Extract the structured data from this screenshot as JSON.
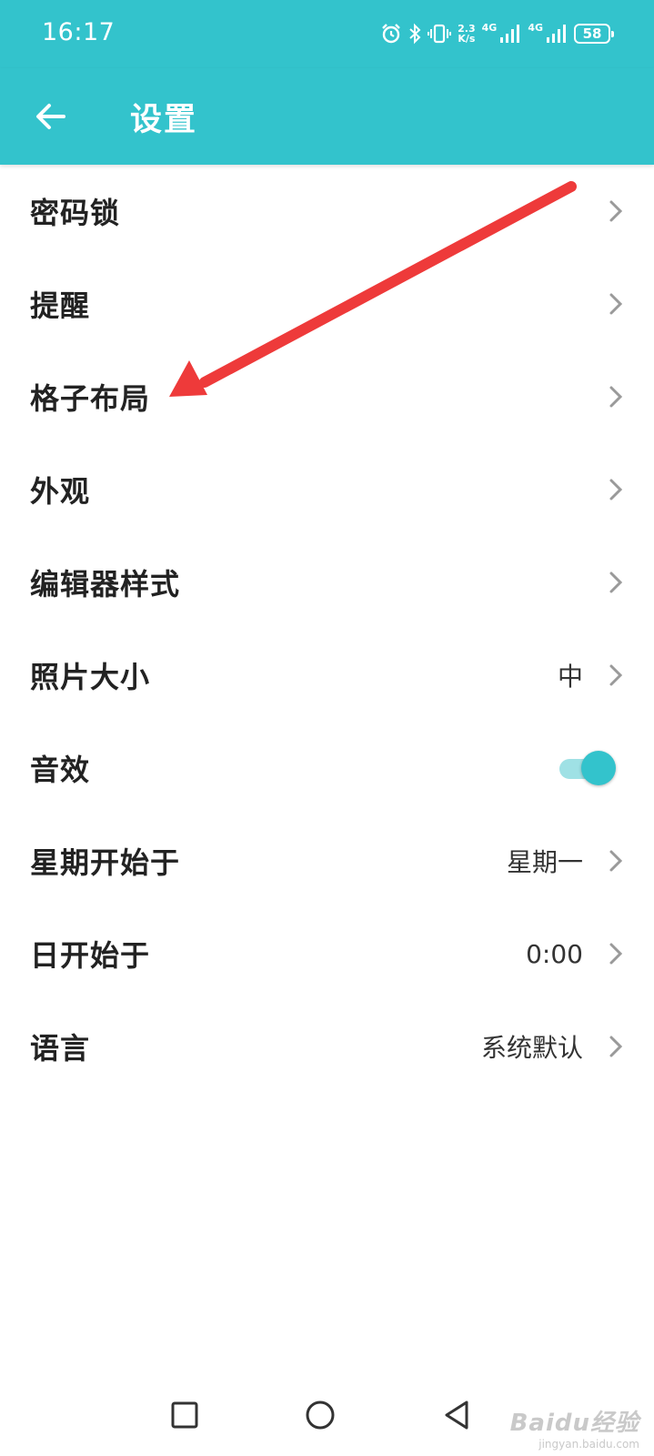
{
  "status_bar": {
    "time": "16:17",
    "speed_value": "2.3",
    "speed_unit": "K/s",
    "network1": "4G",
    "network2": "4G",
    "battery": "58"
  },
  "header": {
    "title": "设置",
    "background": "#33c3cc"
  },
  "settings": {
    "items": [
      {
        "label": "密码锁",
        "value": ""
      },
      {
        "label": "提醒",
        "value": ""
      },
      {
        "label": "格子布局",
        "value": ""
      },
      {
        "label": "外观",
        "value": ""
      },
      {
        "label": "编辑器样式",
        "value": ""
      },
      {
        "label": "照片大小",
        "value": "中"
      },
      {
        "label": "音效",
        "toggle_on": true
      },
      {
        "label": "星期开始于",
        "value": "星期一"
      },
      {
        "label": "日开始于",
        "value": "0:00"
      },
      {
        "label": "语言",
        "value": "系统默认"
      }
    ]
  },
  "annotation": {
    "arrow_color": "#ee3a3a"
  },
  "watermark": {
    "text": "Baidu经验",
    "sub": "jingyan.baidu.com"
  }
}
